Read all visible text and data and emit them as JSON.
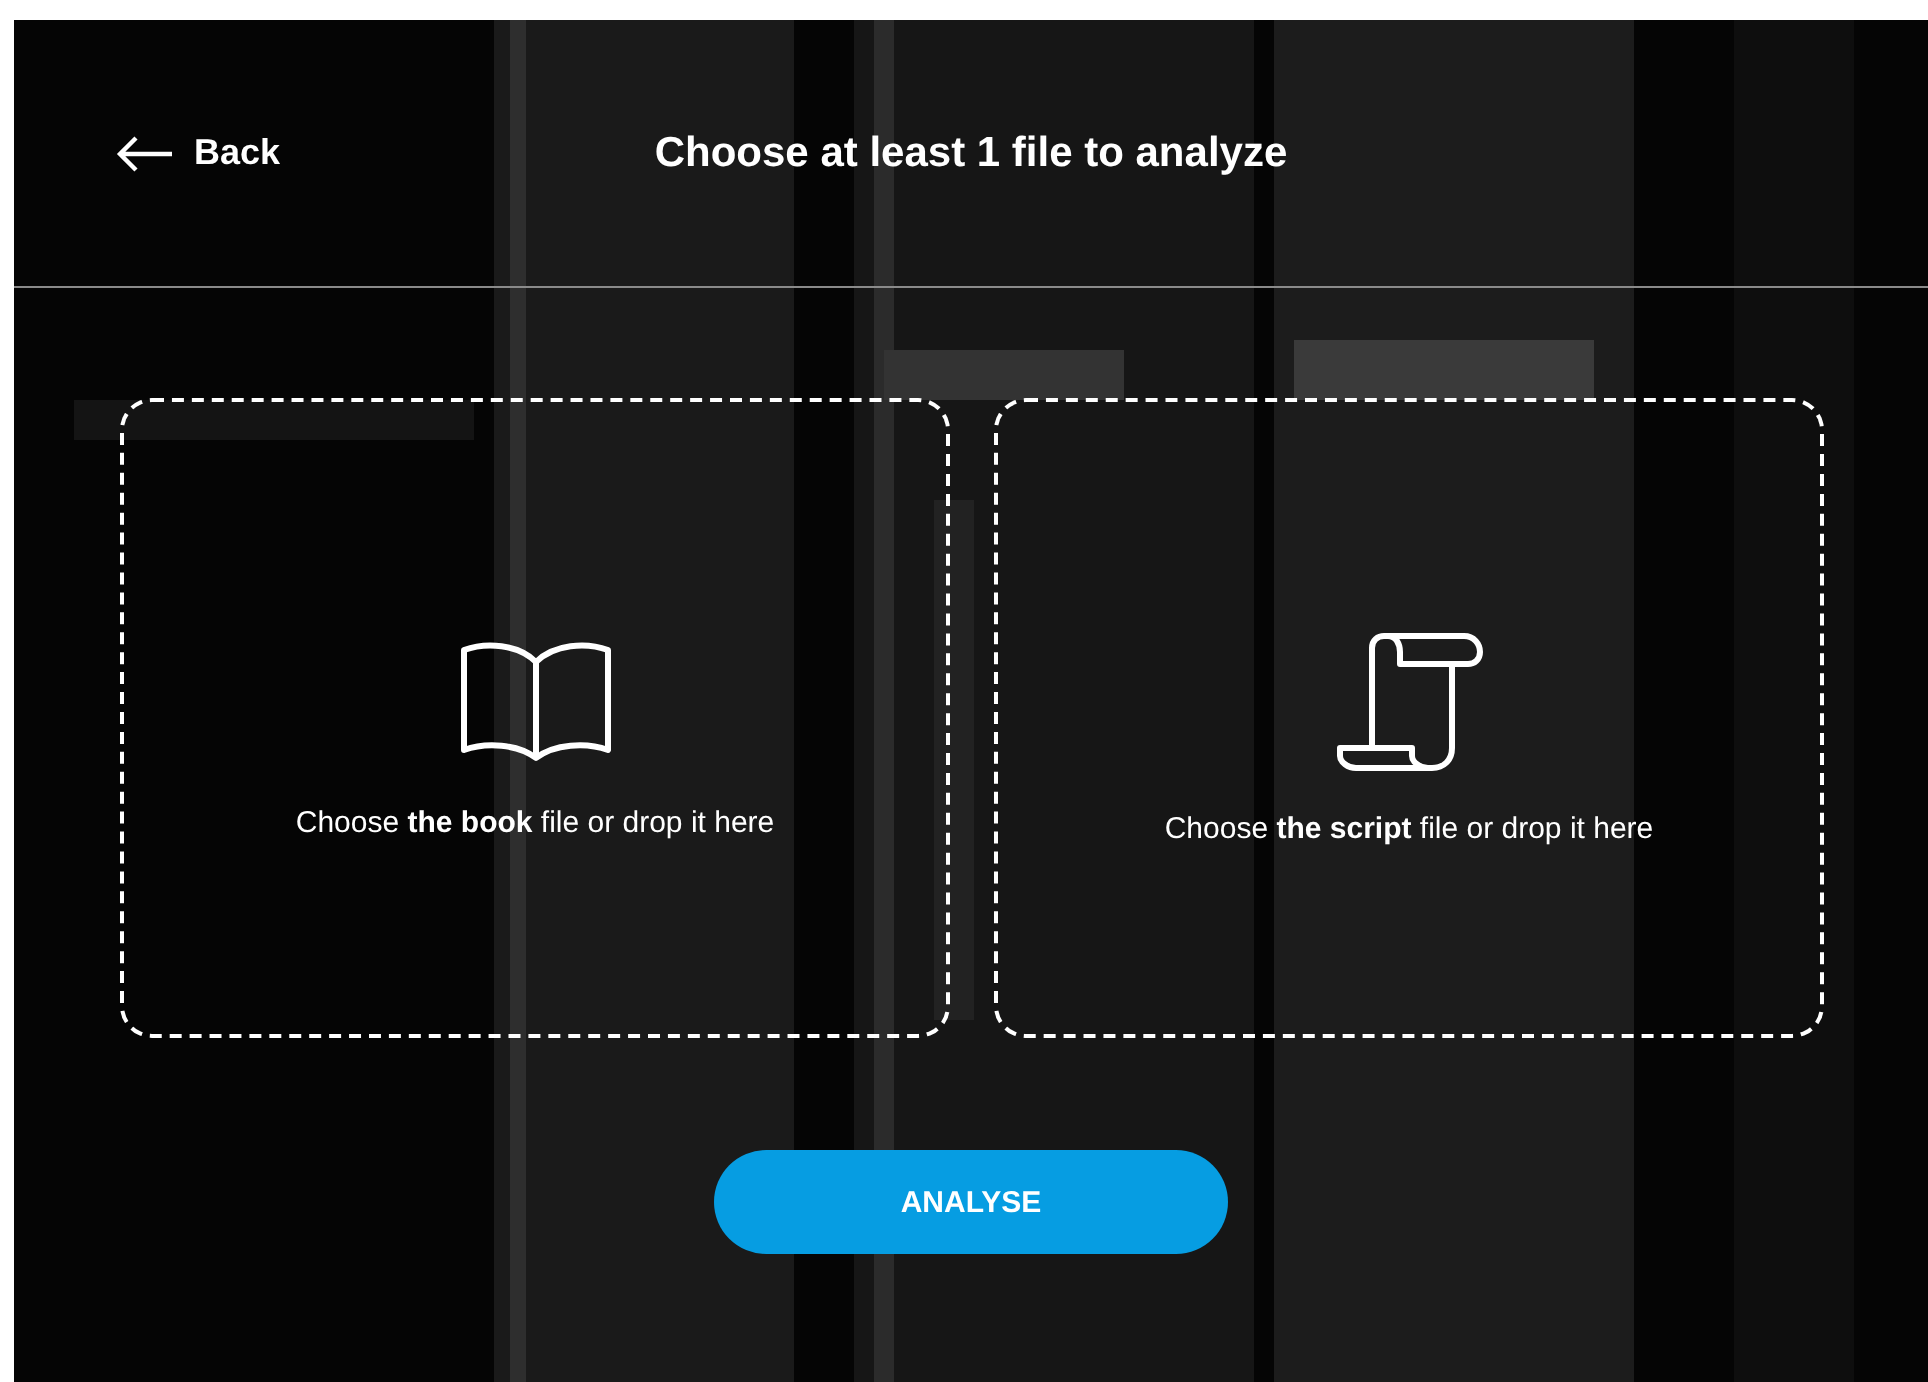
{
  "header": {
    "back": "Back",
    "title": "Choose at least 1 file to analyze"
  },
  "drop_zones": [
    {
      "kind": "book",
      "text": "Choose **the book** file or drop it here"
    },
    {
      "kind": "script",
      "text": "Choose **the script** file or drop it here"
    }
  ],
  "button": {
    "label": "ANALYSE"
  }
}
